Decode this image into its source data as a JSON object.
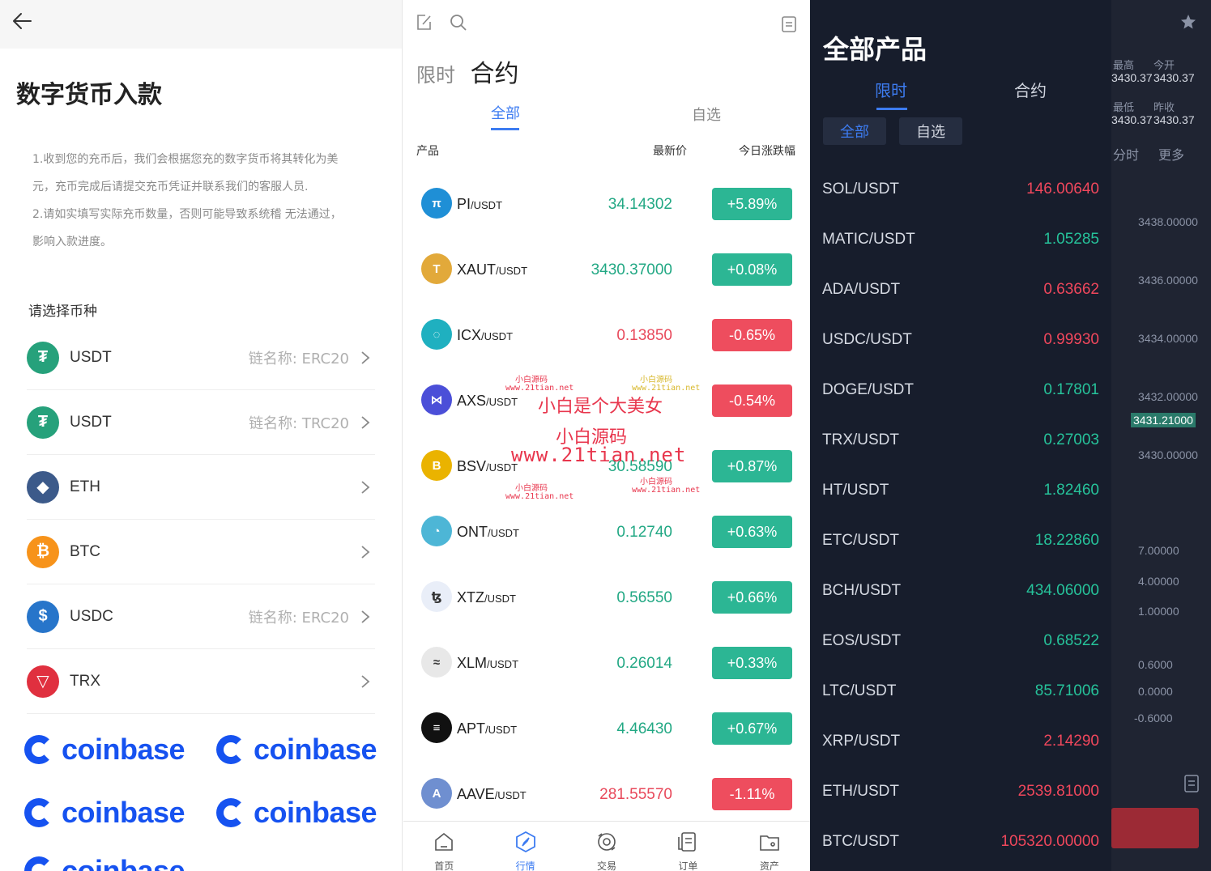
{
  "deposit": {
    "title": "数字货币入款",
    "notes": [
      "1.收到您的充币后，我们会根据您充的数字货币将其转化为美",
      "元，充币完成后请提交充币凭证并联系我们的客服人员.",
      "2.请如实填写实际充币数量，否则可能导致系统稽 无法通过，",
      "影响入款进度。"
    ],
    "select_label": "请选择币种",
    "coins": [
      {
        "name": "USDT",
        "chain": "链名称: ERC20",
        "color": "#26a17b",
        "icon": "tether-icon"
      },
      {
        "name": "USDT",
        "chain": "链名称: TRC20",
        "color": "#26a17b",
        "icon": "tether-icon"
      },
      {
        "name": "ETH",
        "chain": "",
        "color": "#3c5a8a",
        "icon": "ethereum-icon"
      },
      {
        "name": "BTC",
        "chain": "",
        "color": "#f7931a",
        "icon": "bitcoin-icon"
      },
      {
        "name": "USDC",
        "chain": "链名称: ERC20",
        "color": "#2775ca",
        "icon": "usdc-icon"
      },
      {
        "name": "TRX",
        "chain": "",
        "color": "#e0303f",
        "icon": "tron-icon"
      }
    ],
    "brand": "coinbase"
  },
  "market": {
    "mode_limit": "限时",
    "mode_contract": "合约",
    "tab_all": "全部",
    "tab_fav": "自选",
    "col_product": "产品",
    "col_price": "最新价",
    "col_change": "今日涨跌幅",
    "rows": [
      {
        "base": "PI",
        "quote": "/USDT",
        "price": "34.14302",
        "change": "+5.89%",
        "dir": "up",
        "icon_color": "#1f8fd6",
        "glyph": "π"
      },
      {
        "base": "XAUT",
        "quote": "/USDT",
        "price": "3430.37000",
        "change": "+0.08%",
        "dir": "up",
        "icon_color": "#e2a93a",
        "glyph": "T"
      },
      {
        "base": "ICX",
        "quote": "/USDT",
        "price": "0.13850",
        "change": "-0.65%",
        "dir": "down",
        "icon_color": "#1fb0c0",
        "glyph": "◌"
      },
      {
        "base": "AXS",
        "quote": "/USDT",
        "price": "",
        "change": "-0.54%",
        "dir": "down",
        "icon_color": "#4b4fd8",
        "glyph": "⋈"
      },
      {
        "base": "BSV",
        "quote": "/USDT",
        "price": "30.58590",
        "change": "+0.87%",
        "dir": "up",
        "icon_color": "#eab300",
        "glyph": "B"
      },
      {
        "base": "ONT",
        "quote": "/USDT",
        "price": "0.12740",
        "change": "+0.63%",
        "dir": "up",
        "icon_color": "#4db6d6",
        "glyph": "◔"
      },
      {
        "base": "XTZ",
        "quote": "/USDT",
        "price": "0.56550",
        "change": "+0.66%",
        "dir": "up",
        "icon_color": "#e9eef8",
        "glyph": "ꜩ"
      },
      {
        "base": "XLM",
        "quote": "/USDT",
        "price": "0.26014",
        "change": "+0.33%",
        "dir": "up",
        "icon_color": "#e8e8e8",
        "glyph": "≈"
      },
      {
        "base": "APT",
        "quote": "/USDT",
        "price": "4.46430",
        "change": "+0.67%",
        "dir": "up",
        "icon_color": "#111111",
        "glyph": "≡"
      },
      {
        "base": "AAVE",
        "quote": "/USDT",
        "price": "281.55570",
        "change": "-1.11%",
        "dir": "down",
        "icon_color": "#6f8fd0",
        "glyph": "A"
      }
    ],
    "nav": [
      "首页",
      "行情",
      "交易",
      "订单",
      "资产"
    ],
    "watermark": {
      "line1": "小白是个大美女",
      "line2": "小白源码",
      "line3": "www.21tian.net",
      "small_a": "小白源码",
      "small_b": "www.21tian.net"
    }
  },
  "products": {
    "title": "全部产品",
    "mode_limit": "限时",
    "mode_contract": "合约",
    "pill_all": "全部",
    "pill_fav": "自选",
    "rows": [
      {
        "sym": "SOL/USDT",
        "price": "146.00640",
        "dir": "down"
      },
      {
        "sym": "MATIC/USDT",
        "price": "1.05285",
        "dir": "up"
      },
      {
        "sym": "ADA/USDT",
        "price": "0.63662",
        "dir": "down"
      },
      {
        "sym": "USDC/USDT",
        "price": "0.99930",
        "dir": "down"
      },
      {
        "sym": "DOGE/USDT",
        "price": "0.17801",
        "dir": "up"
      },
      {
        "sym": "TRX/USDT",
        "price": "0.27003",
        "dir": "up"
      },
      {
        "sym": "HT/USDT",
        "price": "1.82460",
        "dir": "up"
      },
      {
        "sym": "ETC/USDT",
        "price": "18.22860",
        "dir": "up"
      },
      {
        "sym": "BCH/USDT",
        "price": "434.06000",
        "dir": "up"
      },
      {
        "sym": "EOS/USDT",
        "price": "0.68522",
        "dir": "up"
      },
      {
        "sym": "LTC/USDT",
        "price": "85.71006",
        "dir": "up"
      },
      {
        "sym": "XRP/USDT",
        "price": "2.14290",
        "dir": "down"
      },
      {
        "sym": "ETH/USDT",
        "price": "2539.81000",
        "dir": "down"
      },
      {
        "sym": "BTC/USDT",
        "price": "105320.00000",
        "dir": "down"
      }
    ],
    "chart_bg": {
      "high_label": "最高",
      "high_val": "3430.37",
      "open_label": "今开",
      "open_val": "3430.37",
      "low_label": "最低",
      "low_val": "3430.37",
      "prev_label": "昨收",
      "prev_val": "3430.37",
      "time_label": "分时",
      "more_label": "更多",
      "axis": [
        "3438.00000",
        "3436.00000",
        "3434.00000",
        "3432.00000",
        "3430.00000"
      ],
      "current": "3431.21000",
      "vol_axis": [
        "7.00000",
        "4.00000",
        "1.00000"
      ],
      "macd_axis": [
        "0.6000",
        "0.0000",
        "-0.6000"
      ]
    }
  }
}
